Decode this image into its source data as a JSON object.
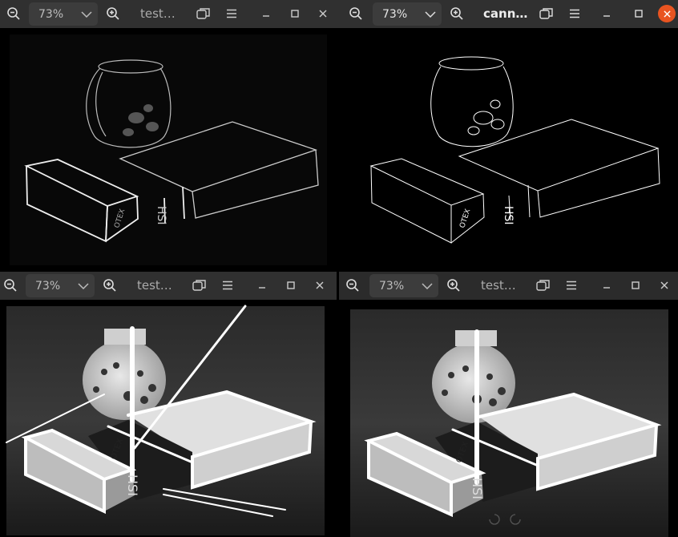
{
  "windows": [
    {
      "id": "tl",
      "zoom": "73%",
      "title": "test…",
      "active": false
    },
    {
      "id": "tr",
      "zoom": "73%",
      "title": "cann…",
      "active": true
    },
    {
      "id": "bl",
      "zoom": "73%",
      "title": "test…",
      "active": false
    },
    {
      "id": "br",
      "zoom": "73%",
      "title": "test…",
      "active": false
    }
  ],
  "images": {
    "box_label_side": "HSI",
    "box_label_front": "OTEX"
  },
  "colors": {
    "titlebar": "#303030",
    "zoombox": "#3c3c3c",
    "close_active": "#e95420",
    "canvas": "#000000"
  },
  "icons": [
    "zoom-out-icon",
    "chevron-down-icon",
    "zoom-in-icon",
    "restore-window-icon",
    "hamburger-menu-icon",
    "minimize-icon",
    "maximize-icon",
    "close-icon"
  ]
}
